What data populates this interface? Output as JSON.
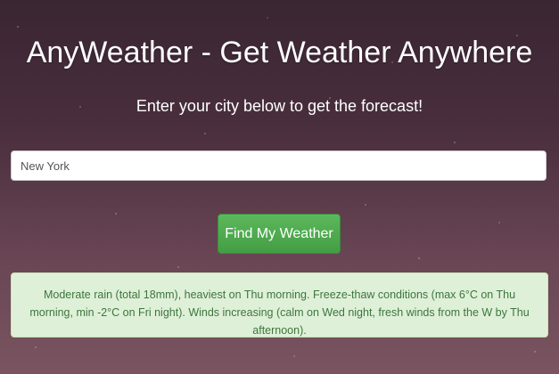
{
  "page": {
    "title": "AnyWeather - Get Weather Anywhere",
    "subtitle": "Enter your city below to get the forecast!"
  },
  "search": {
    "value": "New York",
    "button_label": "Find My Weather"
  },
  "forecast": {
    "text": "Moderate rain (total 18mm), heaviest on Thu morning. Freeze-thaw conditions (max 6°C on Thu morning, min -2°C on Fri night). Winds increasing (calm on Wed night, fresh winds from the W by Thu afternoon)."
  },
  "colors": {
    "button_green": "#5cb85c",
    "alert_background": "#dff0d8",
    "alert_text": "#3c763d",
    "background_top": "#3a2533",
    "background_bottom": "#7a5460"
  }
}
